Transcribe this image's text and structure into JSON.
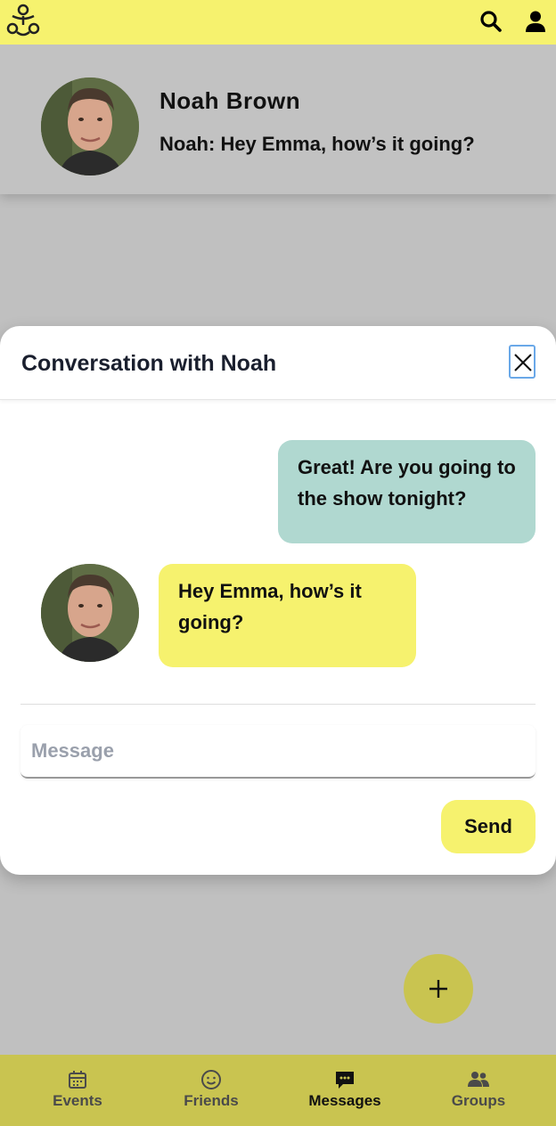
{
  "topbar": {
    "logo_icon": "people-circle-logo-icon",
    "search_icon": "search-icon",
    "profile_icon": "user-icon",
    "background": "#f6f26e"
  },
  "list": {
    "name": "Noah Brown",
    "preview": "Noah: Hey Emma, how’s it going?"
  },
  "modal": {
    "title": "Conversation with Noah",
    "messages": [
      {
        "direction": "outgoing",
        "text": "Great! Are you going to the show tonight?",
        "color": "#b0d8d0"
      },
      {
        "direction": "incoming",
        "text": "Hey Emma, how’s it going?",
        "color": "#f6f26e"
      }
    ],
    "input_placeholder": "Message",
    "input_value": "",
    "send_label": "Send"
  },
  "fab": {
    "icon": "plus-icon",
    "color": "#c9c450"
  },
  "nav": {
    "items": [
      {
        "label": "Events",
        "icon": "calendar-icon",
        "active": false
      },
      {
        "label": "Friends",
        "icon": "smiley-icon",
        "active": false
      },
      {
        "label": "Messages",
        "icon": "chat-icon",
        "active": true
      },
      {
        "label": "Groups",
        "icon": "group-icon",
        "active": false
      }
    ],
    "background": "#c9c450"
  }
}
